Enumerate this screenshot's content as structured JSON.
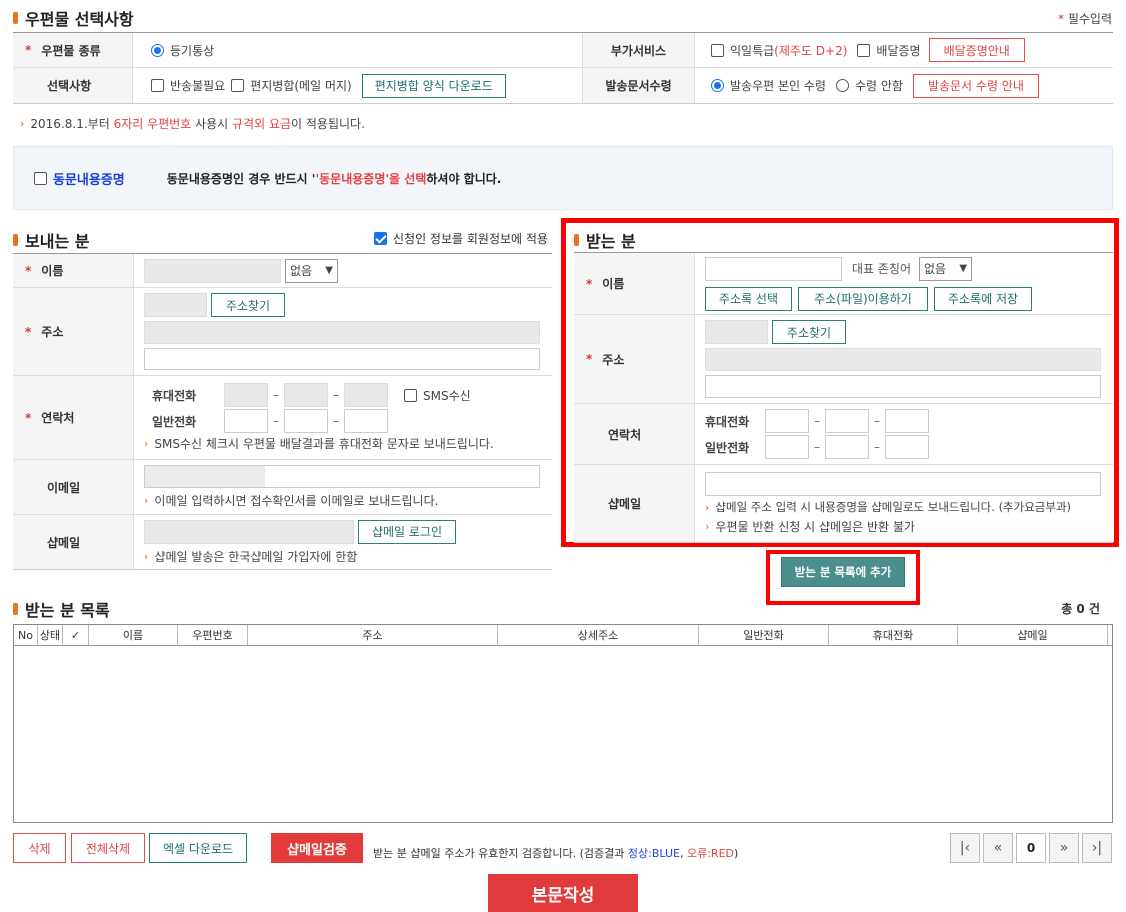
{
  "mail_option": {
    "title": "우편물 선택사항",
    "required_note": "필수입력",
    "type_label": "우편물 종류",
    "type_value": "등기통상",
    "option_label": "선택사항",
    "opt_return": "반송불필요",
    "opt_merge": "편지병합(메일 머지)",
    "merge_download": "편지병합 양식 다운로드",
    "addl_label": "부가서비스",
    "addl_next_day": "익일특급",
    "addl_next_day_note": "(제주도 D+2)",
    "addl_delivery_proof": "배달증명",
    "delivery_proof_guide": "배달증명안내",
    "receive_label": "발송문서수령",
    "receive_self": "발송우편 본인 수령",
    "receive_none": "수령 안함",
    "receive_guide": "발송문서 수령 안내",
    "notice_prefix": "2016.8.1.부터 ",
    "notice_red1": "6자리 우편번호",
    "notice_mid": " 사용시 ",
    "notice_red2": "규격외 요금",
    "notice_suffix": "이 적용됩니다."
  },
  "same_content": {
    "label": "동문내용증명",
    "desc_prefix": "동문내용증명인 경우 반드시 '",
    "desc_red": "'동문내용증명'을 선택",
    "desc_suffix": "하셔야 합니다."
  },
  "sender": {
    "title": "보내는 분",
    "apply_member": "신청인 정보를 회원정보에 적용",
    "name_label": "이름",
    "honorific_value": "없음",
    "address_label": "주소",
    "find_address": "주소찾기",
    "contact_label": "연락처",
    "mobile_label": "휴대전화",
    "phone_label": "일반전화",
    "sms_label": "SMS수신",
    "sms_note": "SMS수신 체크시 우편물 배달결과를 휴대전화 문자로 보내드립니다.",
    "email_label": "이메일",
    "email_note": "이메일 입력하시면 접수확인서를 이메일로 보내드립니다.",
    "shop_label": "샵메일",
    "shop_login": "샵메일 로그인",
    "shop_note": "샵메일 발송은 한국샵메일 가입자에 한함"
  },
  "receiver": {
    "title": "받는 분",
    "name_label": "이름",
    "honorific_label": "대표 존칭어",
    "honorific_value": "없음",
    "btn_addressbook": "주소록 선택",
    "btn_file": "주소(파일)이용하기",
    "btn_save": "주소록에 저장",
    "address_label": "주소",
    "find_address": "주소찾기",
    "contact_label": "연락처",
    "mobile_label": "휴대전화",
    "phone_label": "일반전화",
    "shop_label": "샵메일",
    "shop_note1": "샵메일 주소 입력 시 내용증명을 샵메일로도 보내드립니다. (추가요금부과)",
    "shop_note2": "우편물 반환 신청 시 샵메일은 반환 불가",
    "add_button": "받는 분 목록에 추가"
  },
  "list": {
    "title": "받는 분 목록",
    "total": "총 0 건",
    "columns": [
      "No",
      "상태",
      "✓",
      "이름",
      "우편번호",
      "주소",
      "상세주소",
      "일반전화",
      "휴대전화",
      "샵메일"
    ],
    "btn_delete": "삭제",
    "btn_delete_all": "전체삭제",
    "btn_excel": "엑셀 다운로드",
    "btn_verify": "샵메일검증",
    "verify_prefix": "받는 분 샵메일 주소가 유효한지 검증합니다. (검증결과 ",
    "verify_blue": "정상:BLUE",
    "verify_sep": ", ",
    "verify_red": "오류:RED",
    "verify_suffix": ")",
    "page_current": "0"
  },
  "compose_button": "본문작성",
  "colors": {
    "accent": "#e8731c",
    "teal": "#4a8f8b",
    "red": "#e23b3b",
    "highlight": "#ff0000"
  }
}
